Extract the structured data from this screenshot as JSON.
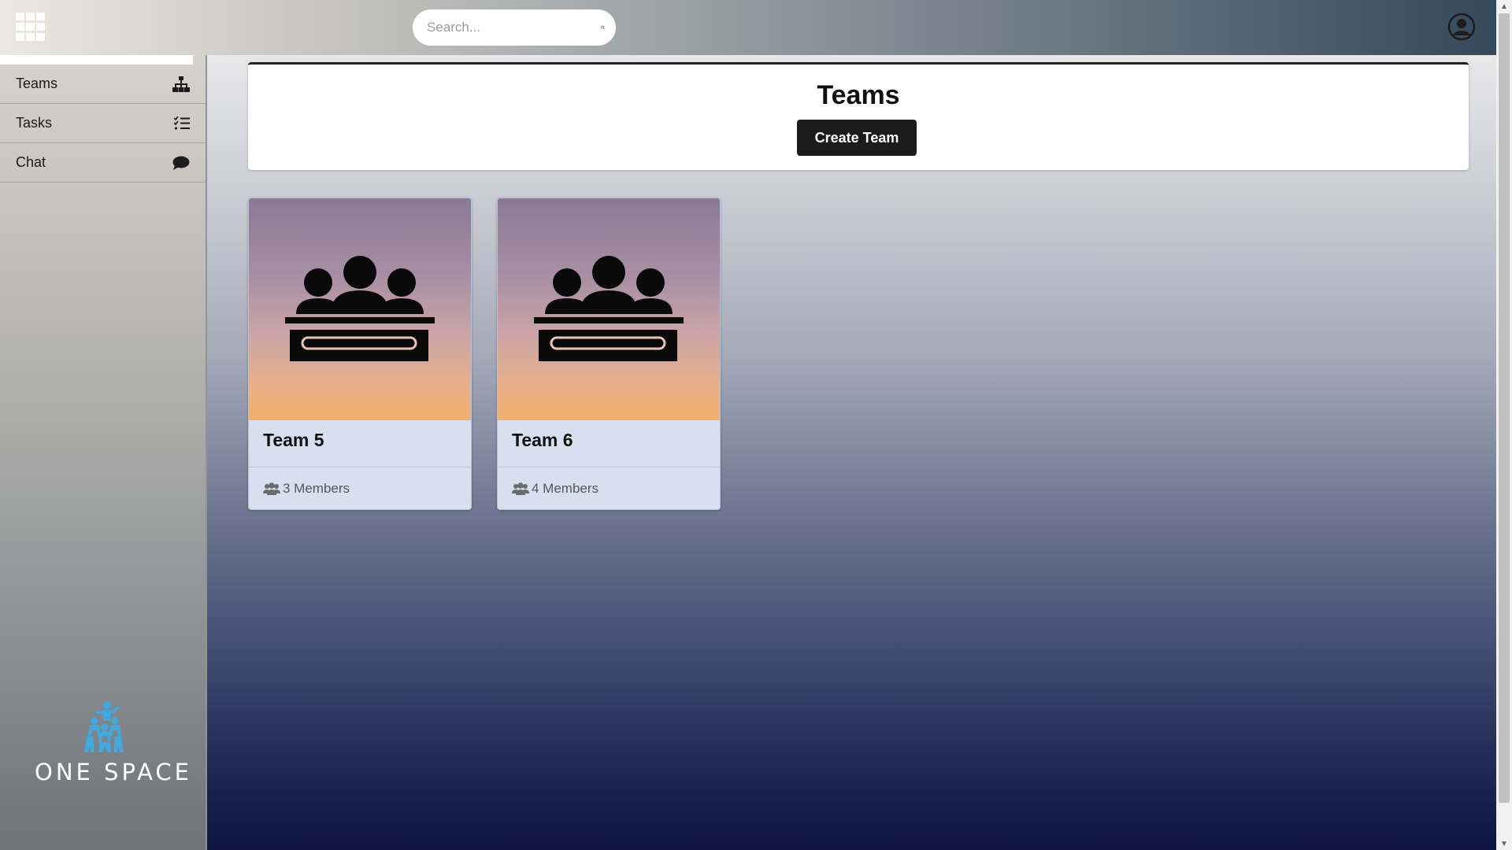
{
  "topbar": {
    "apps_icon": "grid-icon",
    "search": {
      "placeholder": "Search...",
      "value": "",
      "icon": "search-icon"
    },
    "user_icon": "user-circle-icon"
  },
  "sidebar": {
    "items": [
      {
        "label": "Teams",
        "icon": "sitemap-icon"
      },
      {
        "label": "Tasks",
        "icon": "task-list-icon"
      },
      {
        "label": "Chat",
        "icon": "chat-bubble-icon"
      }
    ],
    "logo": {
      "text": "ONE SPACE",
      "color": "#3fa9e0"
    }
  },
  "main": {
    "title": "Teams",
    "create_button": "Create Team",
    "teams": [
      {
        "name": "Team 5",
        "members": "3 Members",
        "icon": "team-meeting-icon"
      },
      {
        "name": "Team 6",
        "members": "4 Members",
        "icon": "team-meeting-icon"
      }
    ]
  },
  "colors": {
    "button_bg": "#1b1b1b",
    "card_bg": "#d8e0ef",
    "logo_accent": "#3fa9e0"
  }
}
